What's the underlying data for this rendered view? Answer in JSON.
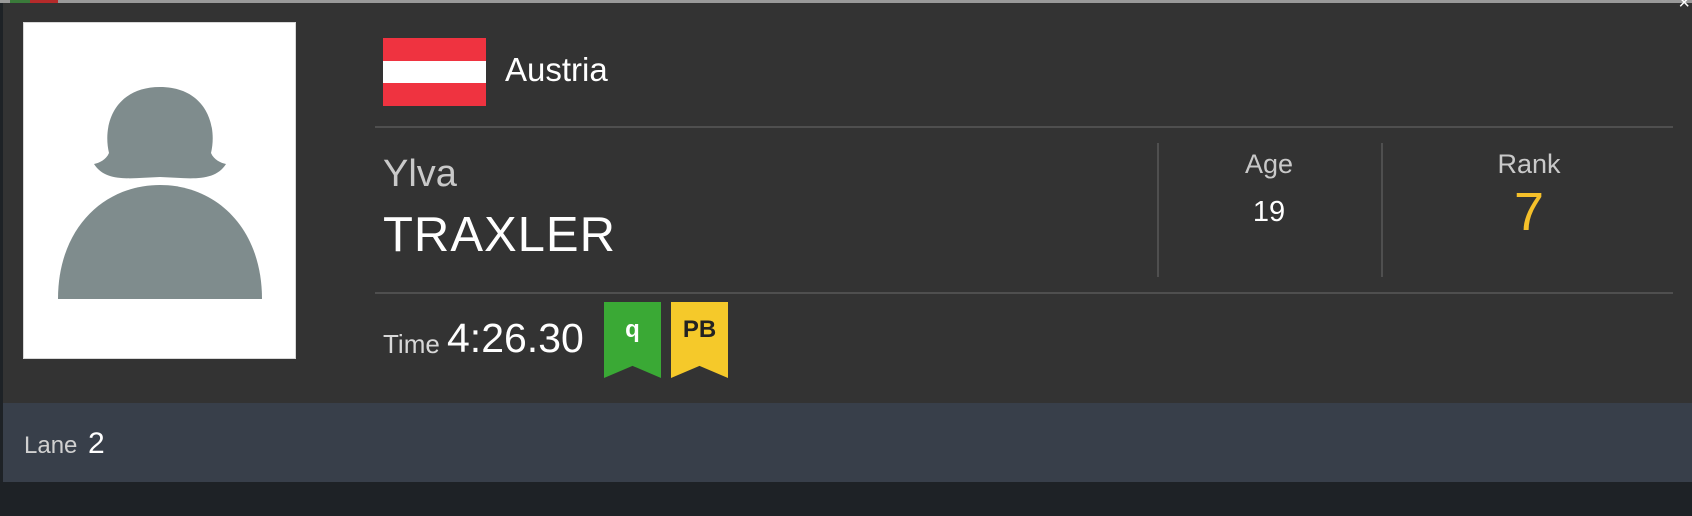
{
  "window": {
    "close_glyph": "×"
  },
  "athlete": {
    "country": "Austria",
    "flag_colors": [
      "#ef3340",
      "#ffffff",
      "#ef3340"
    ],
    "first_name": "Ylva",
    "last_name": "TRAXLER",
    "photo": "avatar-placeholder-icon"
  },
  "stats": {
    "age_label": "Age",
    "age_value": "19",
    "rank_label": "Rank",
    "rank_value": "7",
    "rank_color": "#f5c02a"
  },
  "result": {
    "time_label": "Time",
    "time_value": "4:26.30",
    "badges": [
      {
        "label": "q",
        "bg": "#3aa935",
        "fg": "#ffffff"
      },
      {
        "label": "PB",
        "bg": "#f5c92a",
        "fg": "#222222"
      }
    ]
  },
  "lane": {
    "label": "Lane",
    "value": "2"
  }
}
